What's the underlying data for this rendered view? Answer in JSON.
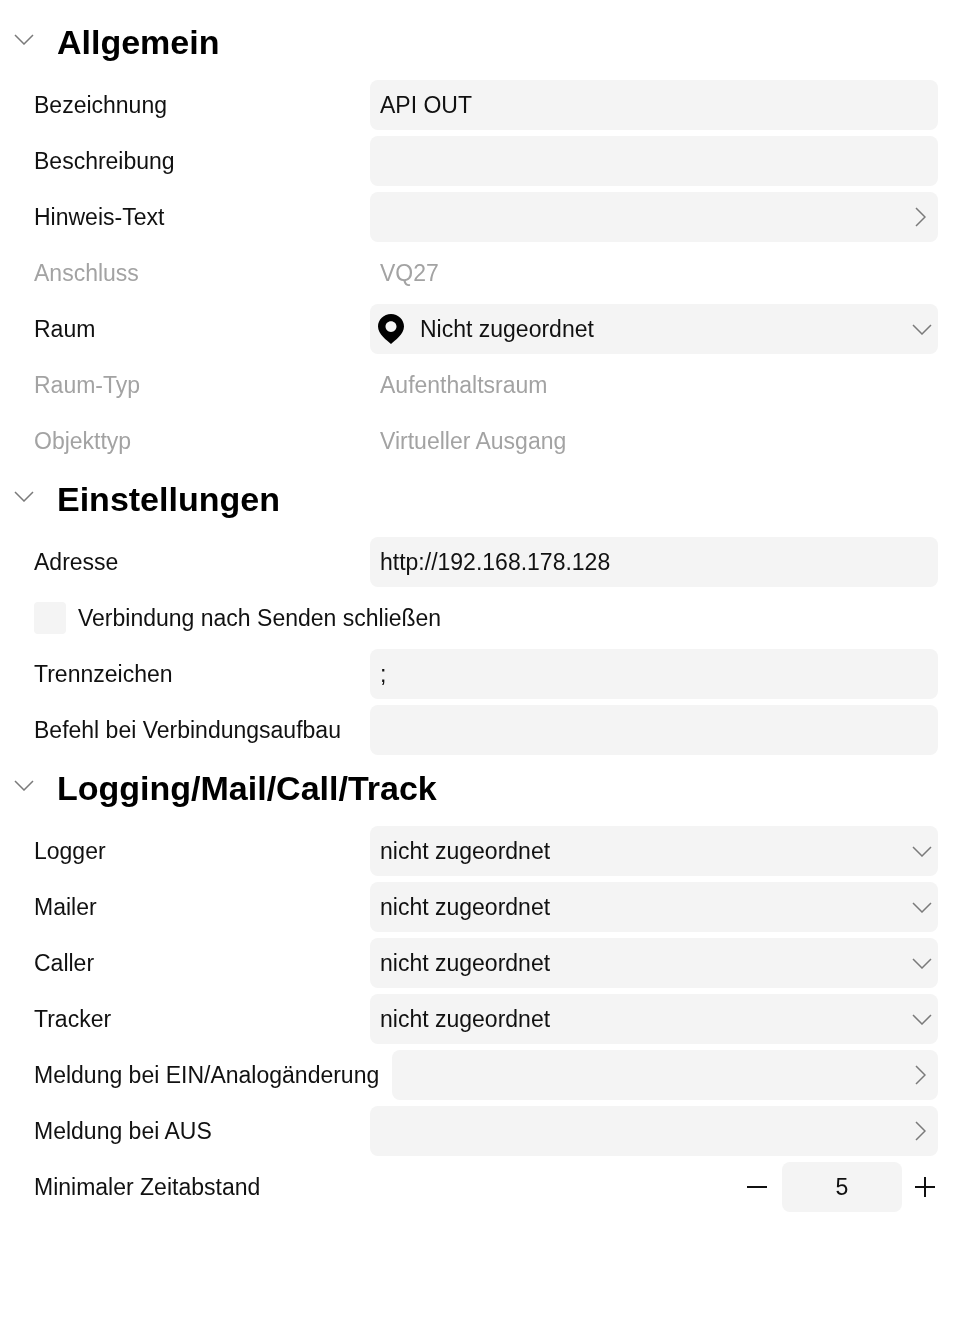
{
  "sections": [
    {
      "title": "Allgemein",
      "expanded": true,
      "rows": [
        {
          "kind": "text",
          "label": "Bezeichnung",
          "value": "API OUT"
        },
        {
          "kind": "text",
          "label": "Beschreibung"
        },
        {
          "kind": "link",
          "label": "Hinweis-Text"
        },
        {
          "kind": "readonly",
          "label": "Anschluss",
          "value": "VQ27"
        },
        {
          "kind": "location",
          "label": "Raum",
          "value": "Nicht zugeordnet"
        },
        {
          "kind": "readonly",
          "label": "Raum-Typ",
          "value": "Aufenthaltsraum"
        },
        {
          "kind": "readonly",
          "label": "Objekttyp",
          "value": "Virtueller Ausgang"
        }
      ]
    },
    {
      "title": "Einstellungen",
      "expanded": true,
      "rows": [
        {
          "kind": "text",
          "label": "Adresse",
          "value": "http://192.168.178.128"
        },
        {
          "kind": "checkbox",
          "label": "Verbindung nach Senden schließen",
          "checked": false
        },
        {
          "kind": "text",
          "label": "Trennzeichen",
          "value": ";"
        },
        {
          "kind": "text",
          "label": "Befehl bei Verbindungsaufbau"
        }
      ]
    },
    {
      "title": "Logging/Mail/Call/Track",
      "expanded": true,
      "rows": [
        {
          "kind": "dropdown",
          "label": "Logger",
          "value": "nicht zugeordnet"
        },
        {
          "kind": "dropdown",
          "label": "Mailer",
          "value": "nicht zugeordnet"
        },
        {
          "kind": "dropdown",
          "label": "Caller",
          "value": "nicht zugeordnet"
        },
        {
          "kind": "dropdown",
          "label": "Tracker",
          "value": "nicht zugeordnet"
        },
        {
          "kind": "link",
          "label": "Meldung bei EIN/Analogänderung"
        },
        {
          "kind": "link",
          "label": "Meldung bei AUS"
        },
        {
          "kind": "stepper",
          "label": "Minimaler Zeitabstand",
          "value": "5"
        }
      ]
    }
  ]
}
